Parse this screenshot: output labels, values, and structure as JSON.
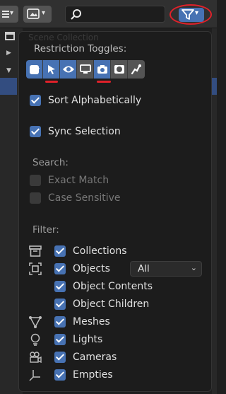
{
  "background_outliner": {
    "ghost_text": "Scene Collection"
  },
  "restriction_toggles": {
    "label": "Restriction Toggles:",
    "items": [
      {
        "name": "checkbox-icon",
        "active": true
      },
      {
        "name": "select-cursor-icon",
        "active": false
      },
      {
        "name": "eye-icon",
        "active": false
      },
      {
        "name": "monitor-icon",
        "active": false
      },
      {
        "name": "camera-icon",
        "active": false
      },
      {
        "name": "holdout-icon",
        "active": false
      },
      {
        "name": "indirect-only-icon",
        "active": false
      }
    ]
  },
  "options": {
    "sort_alphabetically": {
      "label": "Sort Alphabetically",
      "checked": true
    },
    "sync_selection": {
      "label": "Sync Selection",
      "checked": true
    }
  },
  "search": {
    "label": "Search:",
    "exact_match": {
      "label": "Exact Match",
      "checked": false
    },
    "case_sensitive": {
      "label": "Case Sensitive",
      "checked": false
    }
  },
  "filter": {
    "label": "Filter:",
    "collections": {
      "label": "Collections",
      "checked": true,
      "icon": "collection-box-icon"
    },
    "objects": {
      "label": "Objects",
      "checked": true,
      "icon": "object-bounds-icon",
      "dropdown_value": "All"
    },
    "object_contents": {
      "label": "Object Contents",
      "checked": true
    },
    "object_children": {
      "label": "Object Children",
      "checked": true
    },
    "meshes": {
      "label": "Meshes",
      "checked": true,
      "icon": "mesh-icon"
    },
    "lights": {
      "label": "Lights",
      "checked": true,
      "icon": "light-bulb-icon"
    },
    "cameras": {
      "label": "Cameras",
      "checked": true,
      "icon": "camera-icon"
    },
    "empties": {
      "label": "Empties",
      "checked": true,
      "icon": "empty-axes-icon"
    }
  },
  "colors": {
    "accent": "#4772b3",
    "annotation_red": "#e0212a",
    "panel_bg": "#1c1c1c"
  }
}
